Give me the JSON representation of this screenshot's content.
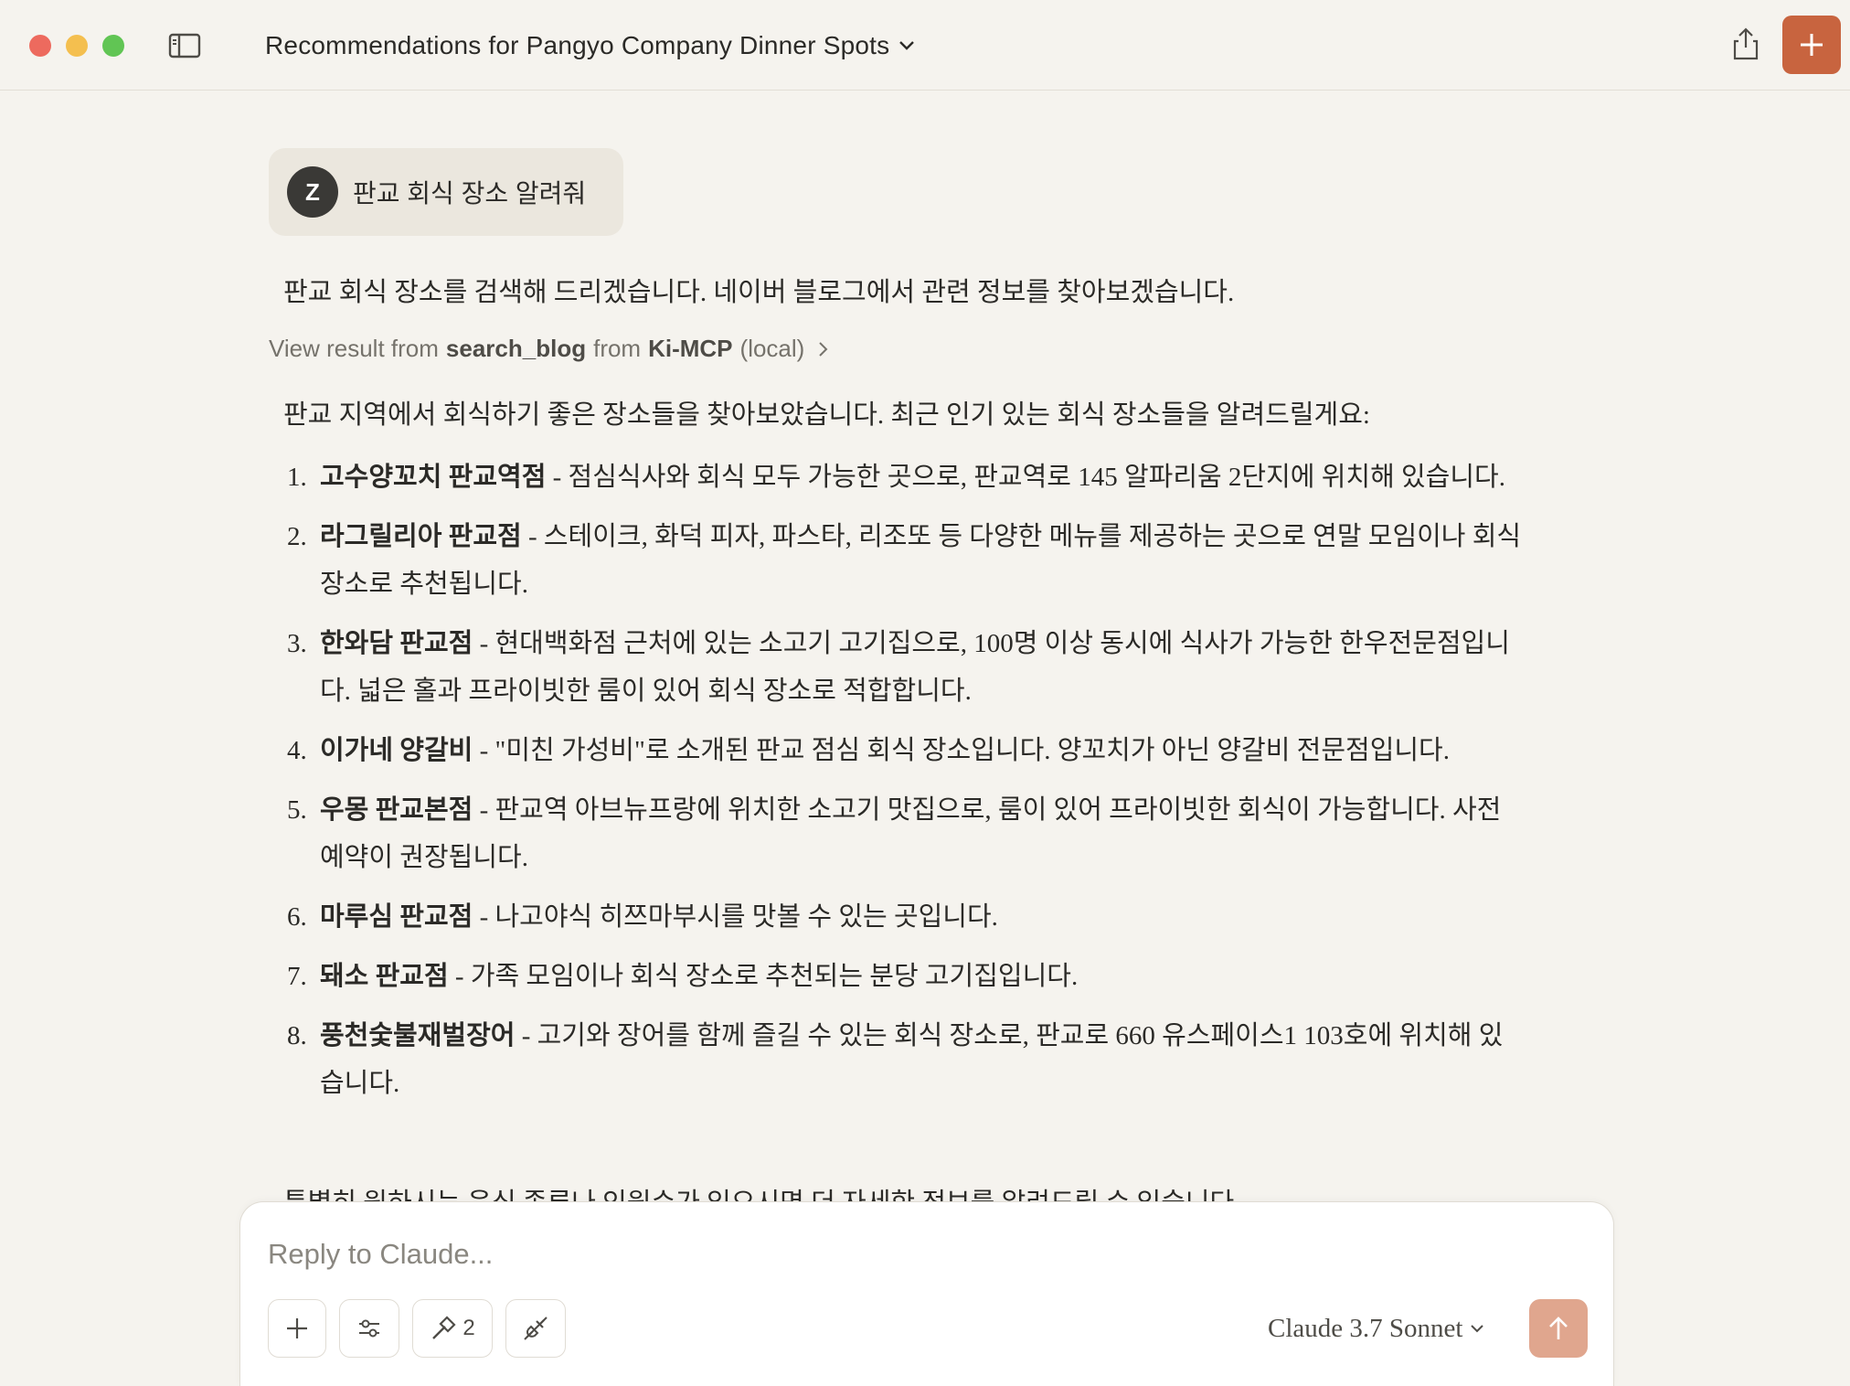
{
  "window": {
    "title": "Recommendations for Pangyo Company Dinner Spots"
  },
  "user_message": {
    "avatar_initial": "Z",
    "text": "판교 회식 장소 알려줘"
  },
  "assistant": {
    "intro": "판교 회식 장소를 검색해 드리겠습니다. 네이버 블로그에서 관련 정보를 찾아보겠습니다.",
    "tool_result": {
      "prefix": "View result from",
      "tool": "search_blog",
      "from_word": "from",
      "server": "Ki-MCP",
      "suffix": "(local)"
    },
    "lead": "판교 지역에서 회식하기 좋은 장소들을 찾아보았습니다. 최근 인기 있는 회식 장소들을 알려드릴게요:",
    "items": [
      {
        "num": "1.",
        "name": "고수양꼬치 판교역점",
        "desc": " - 점심식사와 회식 모두 가능한 곳으로, 판교역로 145 알파리움 2단지에 위치해 있습니다."
      },
      {
        "num": "2.",
        "name": "라그릴리아 판교점",
        "desc": " - 스테이크, 화덕 피자, 파스타, 리조또 등 다양한 메뉴를 제공하는 곳으로 연말 모임이나 회식 장소로 추천됩니다."
      },
      {
        "num": "3.",
        "name": "한와담 판교점",
        "desc": " - 현대백화점 근처에 있는 소고기 고기집으로, 100명 이상 동시에 식사가 가능한 한우전문점입니다. 넓은 홀과 프라이빗한 룸이 있어 회식 장소로 적합합니다."
      },
      {
        "num": "4.",
        "name": "이가네 양갈비",
        "desc": " - \"미친 가성비\"로 소개된 판교 점심 회식 장소입니다. 양꼬치가 아닌 양갈비 전문점입니다."
      },
      {
        "num": "5.",
        "name": "우몽 판교본점",
        "desc": " - 판교역 아브뉴프랑에 위치한 소고기 맛집으로, 룸이 있어 프라이빗한 회식이 가능합니다. 사전 예약이 권장됩니다."
      },
      {
        "num": "6.",
        "name": "마루심 판교점",
        "desc": " - 나고야식 히쯔마부시를 맛볼 수 있는 곳입니다."
      },
      {
        "num": "7.",
        "name": "돼소 판교점",
        "desc": " - 가족 모임이나 회식 장소로 추천되는 분당 고기집입니다."
      },
      {
        "num": "8.",
        "name": "풍천숯불재벌장어",
        "desc": " - 고기와 장어를 함께 즐길 수 있는 회식 장소로, 판교로 660 유스페이스1 103호에 위치해 있습니다."
      }
    ],
    "closing": "특별히 원하시는 음식 종류나 인원수가 있으시면 더 자세한 정보를 알려드릴 수 있습니다."
  },
  "composer": {
    "placeholder": "Reply to Claude...",
    "tools_count": "2",
    "model": "Claude 3.7 Sonnet"
  },
  "icons": {
    "sidebar_toggle": "sidebar-icon",
    "title_dropdown": "chevron-down-icon",
    "share": "share-icon",
    "new_chat": "plus-icon",
    "tool_result_chevron": "chevron-right-icon",
    "attach": "plus-icon",
    "settings": "sliders-icon",
    "tools": "hammer-icon",
    "connect": "plug-icon",
    "model_dropdown": "chevron-down-icon",
    "send": "arrow-up-icon"
  },
  "colors": {
    "background": "#f5f3ee",
    "accent": "#c8643f",
    "send_disabled": "#e0a68e",
    "user_bubble": "#ebe7de"
  }
}
